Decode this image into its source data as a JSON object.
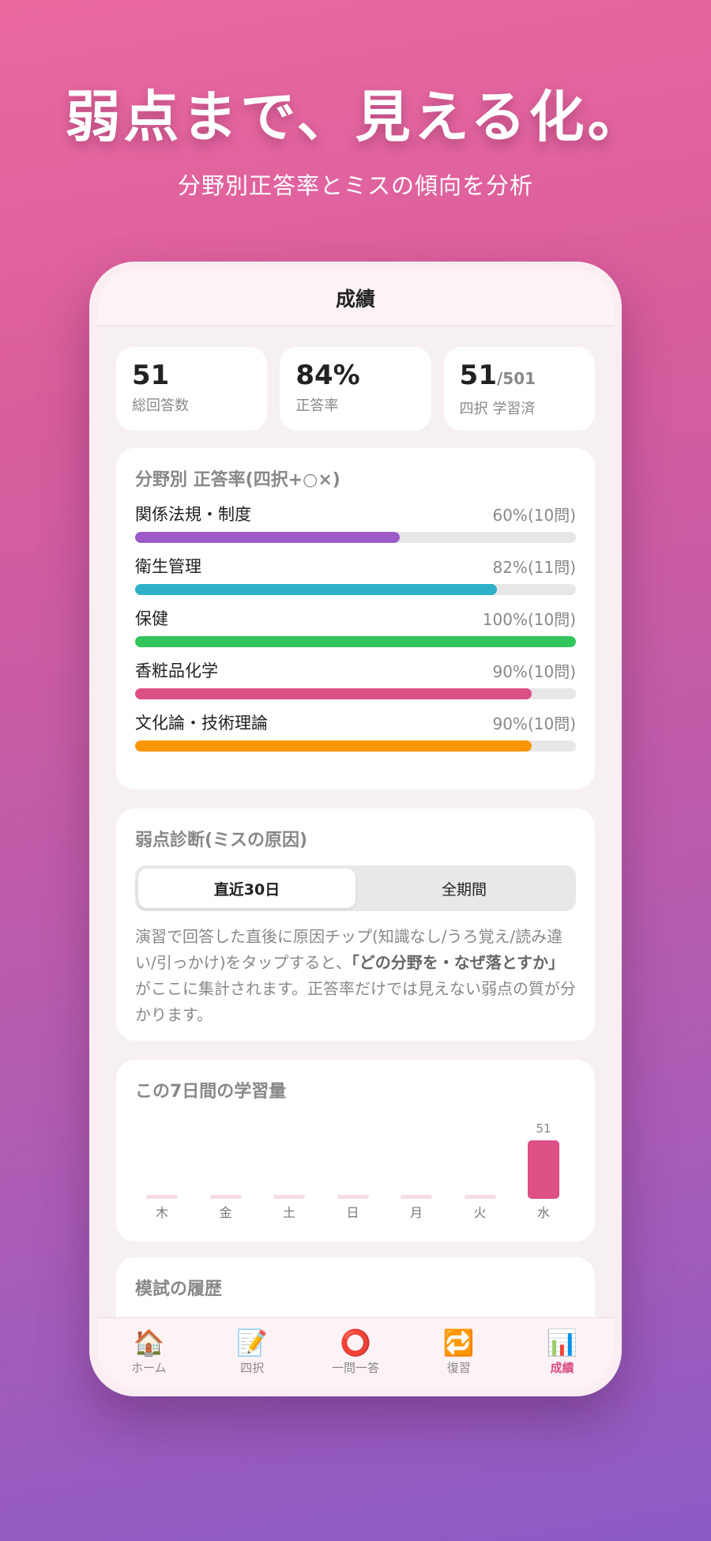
{
  "hero": {
    "title": "弱点まで、見える化。",
    "subtitle": "分野別正答率とミスの傾向を分析"
  },
  "header": {
    "title": "成績"
  },
  "stats": [
    {
      "value": "51",
      "suffix": "",
      "label": "総回答数"
    },
    {
      "value": "84%",
      "suffix": "",
      "label": "正答率"
    },
    {
      "value": "51",
      "suffix": "/501",
      "label": "四択 学習済"
    }
  ],
  "categories": {
    "title": "分野別 正答率(四択+○×)",
    "items": [
      {
        "name": "関係法規・制度",
        "value_text": "60%(10問)",
        "pct": 60,
        "color": "#9c5bc9"
      },
      {
        "name": "衛生管理",
        "value_text": "82%(11問)",
        "pct": 82,
        "color": "#2eb1c8"
      },
      {
        "name": "保健",
        "value_text": "100%(10問)",
        "pct": 100,
        "color": "#31c55b"
      },
      {
        "name": "香粧品化学",
        "value_text": "90%(10問)",
        "pct": 90,
        "color": "#dc5086"
      },
      {
        "name": "文化論・技術理論",
        "value_text": "90%(10問)",
        "pct": 90,
        "color": "#fa9606"
      }
    ]
  },
  "diagnosis": {
    "title": "弱点診断(ミスの原因)",
    "segments": [
      "直近30日",
      "全期間"
    ],
    "text_before": "演習で回答した直後に原因チップ(知識なし/うろ覚え/読み違い/引っかけ)をタップすると、",
    "text_bold": "「どの分野を・なぜ落とすか」",
    "text_after": "がここに集計されます。正答率だけでは見えない弱点の質が分かります。"
  },
  "weekly": {
    "title": "この7日間の学習量",
    "chart_data": {
      "type": "bar",
      "categories": [
        "木",
        "金",
        "土",
        "日",
        "月",
        "火",
        "水"
      ],
      "values": [
        0,
        0,
        0,
        0,
        0,
        0,
        51
      ],
      "value_labels": [
        "",
        "",
        "",
        "",
        "",
        "",
        "51"
      ],
      "max": 51,
      "color": "#dc5086"
    }
  },
  "history": {
    "title": "模試の履歴"
  },
  "tabbar": {
    "items": [
      {
        "icon": "🏠",
        "label": "ホーム"
      },
      {
        "icon": "📝",
        "label": "四択"
      },
      {
        "icon": "⭕",
        "label": "一問一答"
      },
      {
        "icon": "🔁",
        "label": "復習"
      },
      {
        "icon": "📊",
        "label": "成績"
      }
    ],
    "active_index": 4
  }
}
